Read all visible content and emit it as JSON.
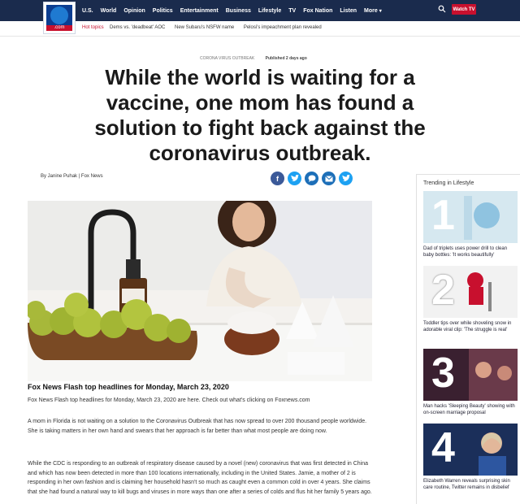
{
  "nav": {
    "logo_text": ".com",
    "items": [
      "U.S.",
      "World",
      "Opinion",
      "Politics",
      "Entertainment",
      "Business",
      "Lifestyle",
      "TV",
      "Fox Nation",
      "Listen",
      "More"
    ],
    "watch_label": "Watch TV"
  },
  "hot_topics": {
    "label": "Hot topics",
    "links": [
      "Dems vs. 'deadbeat' AOC",
      "New Subaru's NSFW name",
      "Pelosi's impeachment plan revealed"
    ]
  },
  "article": {
    "category": "CORONA VIRUS OUTBREAK",
    "published": "Published 2 days ago",
    "headline": "While the world is waiting for a vaccine, one mom has found a solution to fight back against the coronavirus outbreak.",
    "byline": "By Janine Puhak | Fox News",
    "caption_title": "Fox News Flash top headlines for Monday, March 23, 2020",
    "caption_text": "Fox News Flash top headlines for Monday, March 23, 2020 are here. Check out what's clicking on Foxnews.com",
    "paragraphs": [
      "A mom in Florida is not waiting on a solution to the Coronavirus Outbreak that has now spread to over 200 thousand people worldwide. She is taking matters in her own hand and swears that her approach is far better than what most people are doing now.",
      "While the CDC is responding to an outbreak of respiratory disease caused by a novel (new) coronavirus that was first detected in China and which has now been detected in more than 100 locations internationally, including in the United States. Jamie, a mother of 2 is responding in her own fashion and is claiming her household hasn't so much as caught even a common cold in over 4 years. She claims that she had found a natural way to kill bugs and viruses in more ways than one after a series of colds and flus hit her family 5 years ago."
    ]
  },
  "share_icons": [
    "facebook-icon",
    "twitter-icon",
    "comment-icon",
    "email-icon",
    "twitter-share-icon"
  ],
  "sidebar": {
    "title": "Trending in Lifestyle",
    "items": [
      {
        "num": "1",
        "caption": "Dad of triplets uses power drill to clean baby bottles: 'It works beautifully'"
      },
      {
        "num": "2",
        "caption": "Toddler tips over while shoveling snow in adorable viral clip: 'The struggle is real'"
      },
      {
        "num": "3",
        "caption": "Man hacks 'Sleeping Beauty' showing with on-screen marriage proposal"
      },
      {
        "num": "4",
        "caption": "Elizabeth Warren reveals surprising skin care routine, Twitter remains in disbelief"
      }
    ]
  },
  "colors": {
    "nav_bg": "#1a2b4d",
    "accent_red": "#c8102e",
    "share_blue": "#1d6fb8"
  }
}
